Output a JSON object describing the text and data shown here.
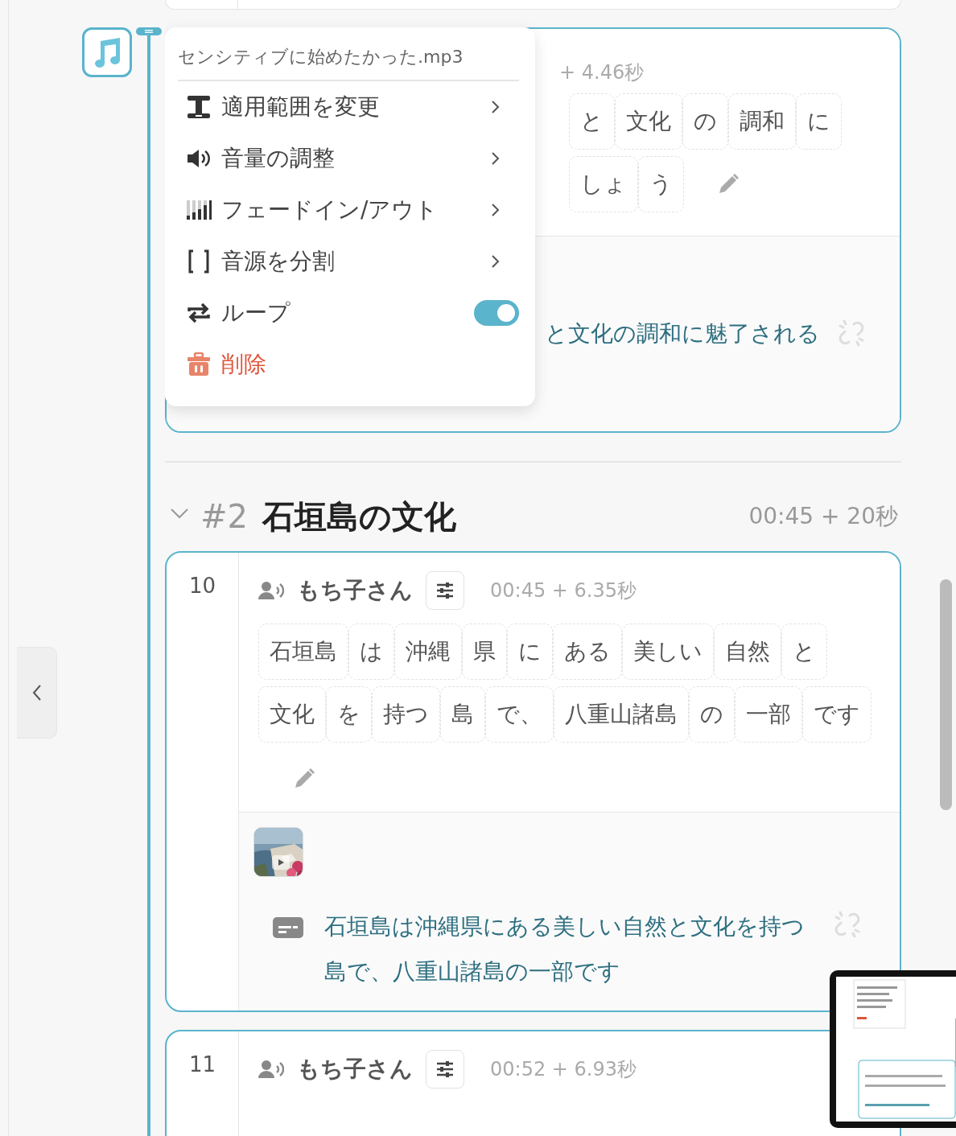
{
  "clip": {
    "menu": {
      "title": "センシティブに始めたかった.mp3",
      "items": [
        {
          "kind": "submenu",
          "label": "適用範囲を変更"
        },
        {
          "kind": "submenu",
          "label": "音量の調整"
        },
        {
          "kind": "submenu",
          "label": "フェードイン/アウト"
        },
        {
          "kind": "submenu",
          "label": "音源を分割"
        },
        {
          "kind": "toggle",
          "label": "ループ",
          "on": true
        },
        {
          "kind": "danger",
          "label": "削除"
        }
      ]
    }
  },
  "partial_card": {
    "time": "+ 4.46秒",
    "token_rows": [
      [
        "と",
        "文化",
        "の",
        "調和",
        "に"
      ],
      [
        "しょ",
        "う"
      ]
    ],
    "translation": "と文化の調和に魅了される"
  },
  "sections": [
    {
      "number": "#2",
      "title": "石垣島の文化",
      "time": "00:45 + 20秒",
      "expanded": true,
      "cards": [
        {
          "index": "10",
          "speaker": "もち子さん",
          "time": "00:45 + 6.35秒",
          "token_rows": [
            [
              "石垣島",
              "は",
              "沖縄",
              "県",
              "に",
              "ある",
              "美しい",
              "自然",
              "と"
            ],
            [
              "文化",
              "を",
              "持つ",
              "島",
              "で、",
              "八重山諸島",
              "の",
              "一部",
              "です"
            ]
          ],
          "translation": "石垣島は沖縄県にある美しい自然と文化を持つ島で、八重山諸島の一部です"
        },
        {
          "index": "11",
          "speaker": "もち子さん",
          "time": "00:52 + 6.93秒"
        }
      ]
    }
  ]
}
